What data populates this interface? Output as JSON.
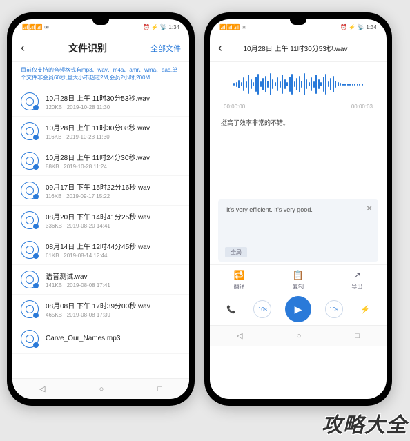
{
  "status": {
    "time": "1:34",
    "iconsLeft": "📶📶📶 ✉",
    "iconsRight": "⏰ ⚡ 📡"
  },
  "left": {
    "title": "文件识别",
    "action": "全部文件",
    "hint": "目前仅支持的音频格式有mp3、wav、m4a、amr、wma、aac,单个文件非会员60秒,且大小不超过2M,会员2小时,200M",
    "items": [
      {
        "name": "10月28日 上午 11时30分53秒.wav",
        "size": "120KB",
        "date": "2019-10-28 11:30"
      },
      {
        "name": "10月28日 上午 11时30分08秒.wav",
        "size": "116KB",
        "date": "2019-10-28 11:30"
      },
      {
        "name": "10月28日 上午 11时24分30秒.wav",
        "size": "88KB",
        "date": "2019-10-28 11:24"
      },
      {
        "name": "09月17日 下午 15时22分16秒.wav",
        "size": "116KB",
        "date": "2019-09-17 15:22"
      },
      {
        "name": "08月20日 下午 14时41分25秒.wav",
        "size": "336KB",
        "date": "2019-08-20 14:41"
      },
      {
        "name": "08月14日 上午 12时44分45秒.wav",
        "size": "61KB",
        "date": "2019-08-14 12:44"
      },
      {
        "name": "语音测试.wav",
        "size": "141KB",
        "date": "2019-08-08 17:41"
      },
      {
        "name": "08月08日 下午 17时39分00秒.wav",
        "size": "465KB",
        "date": "2019-08-08 17:39"
      },
      {
        "name": "Carve_Our_Names.mp3",
        "size": "",
        "date": ""
      }
    ]
  },
  "right": {
    "title": "10月28日 上午 11时30分53秒.wav",
    "timeStart": "00:00:00",
    "timeEnd": "00:00:03",
    "transcript": "挺高了效率非常的不错。",
    "translation": "It's very efficient. It's very good.",
    "tag": "全局",
    "actions": [
      {
        "label": "翻译",
        "icon": "🔁"
      },
      {
        "label": "复制",
        "icon": "📋"
      },
      {
        "label": "导出",
        "icon": "↗"
      }
    ],
    "controls": {
      "rewindBig": "📞",
      "rewind": "10s",
      "forward": "10s",
      "speed": "⚡"
    }
  },
  "watermark": "攻略大全",
  "waveHeights": [
    4,
    7,
    12,
    6,
    20,
    9,
    28,
    14,
    6,
    22,
    30,
    8,
    18,
    24,
    10,
    32,
    14,
    6,
    20,
    9,
    28,
    14,
    6,
    22,
    30,
    8,
    18,
    24,
    10,
    32,
    14,
    6,
    20,
    9,
    28,
    14,
    6,
    22,
    30,
    8,
    18,
    24,
    10,
    6,
    4,
    3,
    3,
    3,
    3,
    3,
    3,
    3,
    3,
    3
  ]
}
